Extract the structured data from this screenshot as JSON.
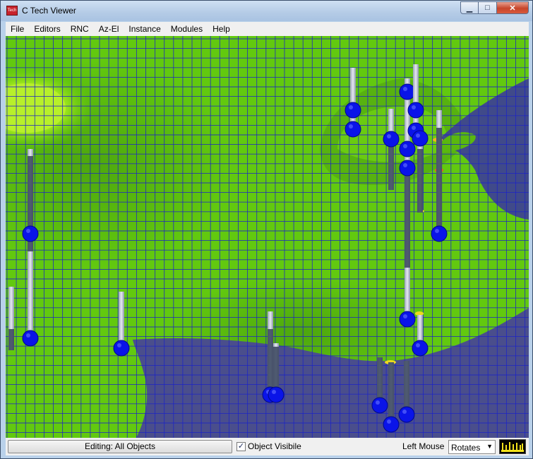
{
  "window": {
    "title": "C Tech Viewer",
    "app_icon_text": "Tech",
    "min_glyph": "▁",
    "max_glyph": "□",
    "close_glyph": "✕"
  },
  "menu": [
    "File",
    "Editors",
    "RNC",
    "Az-El",
    "Instance",
    "Modules",
    "Help"
  ],
  "status": {
    "edit_button": "Editing: All Objects",
    "object_visible_label": "Object Visibile",
    "object_visible_checked": true,
    "left_mouse_label": "Left Mouse",
    "left_mouse_mode": "Rotates"
  },
  "colors": {
    "terrain_green": "#62c90f",
    "terrain_highlight": "#b5ef2a",
    "water_blue": "#4a4e8c",
    "grid_blue": "#1d24c6",
    "well_marker_blue": "#0a14e8"
  }
}
